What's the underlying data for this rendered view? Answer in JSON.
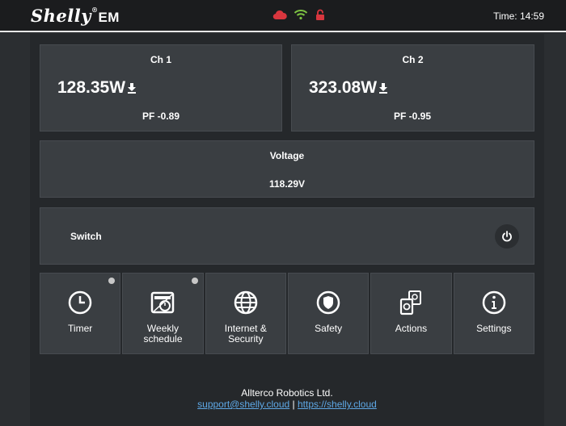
{
  "header": {
    "logo_text": "Shelly",
    "logo_reg": "®",
    "logo_suffix": "EM",
    "time": "Time: 14:59",
    "status_icons": [
      "cloud-icon",
      "wifi-icon",
      "lock-icon"
    ],
    "status_colors": {
      "cloud": "#d9363e",
      "wifi": "#7dc242",
      "lock": "#d9363e"
    }
  },
  "channels": [
    {
      "title": "Ch 1",
      "power": "128.35W",
      "pf": "PF -0.89"
    },
    {
      "title": "Ch 2",
      "power": "323.08W",
      "pf": "PF -0.95"
    }
  ],
  "voltage": {
    "title": "Voltage",
    "value": "118.29V"
  },
  "switch": {
    "label": "Switch"
  },
  "tiles": [
    {
      "label": "Timer",
      "icon": "clock-icon",
      "indicator": true
    },
    {
      "label": "Weekly\nschedule",
      "icon": "weekly-schedule-icon",
      "indicator": true
    },
    {
      "label": "Internet &\nSecurity",
      "icon": "globe-icon",
      "indicator": false
    },
    {
      "label": "Safety",
      "icon": "shield-icon",
      "indicator": false
    },
    {
      "label": "Actions",
      "icon": "actions-icon",
      "indicator": false
    },
    {
      "label": "Settings",
      "icon": "info-icon",
      "indicator": false
    }
  ],
  "footer": {
    "company": "Allterco Robotics Ltd.",
    "support_link": "support@shelly.cloud",
    "separator": "|",
    "site_link": "https://shelly.cloud"
  }
}
